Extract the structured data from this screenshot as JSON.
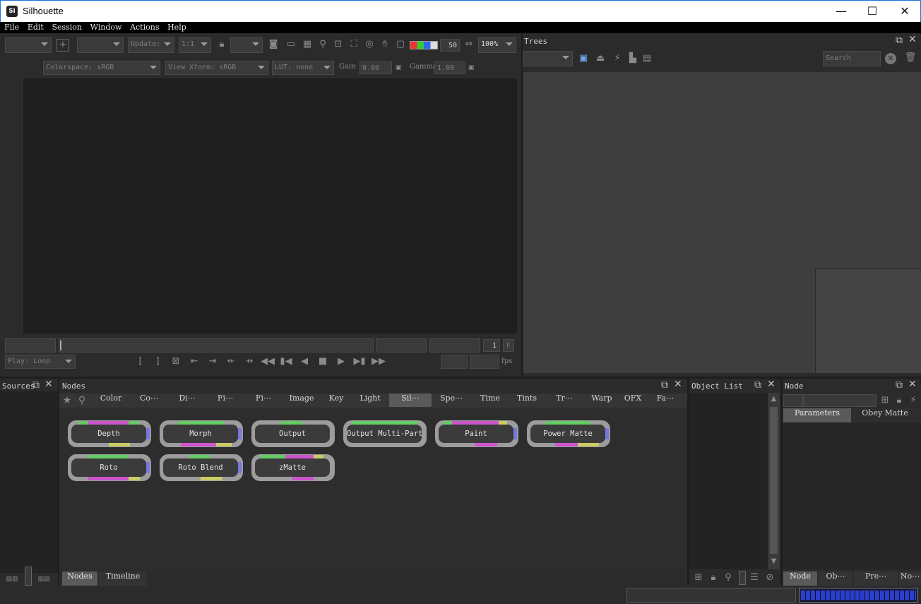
{
  "window": {
    "title": "Silhouette",
    "logo_text": "Si",
    "min": "—",
    "max": "☐",
    "close": "✕"
  },
  "menu": [
    "File",
    "Edit",
    "Session",
    "Window",
    "Actions",
    "Help"
  ],
  "viewer": {
    "update_label": "Update:",
    "ratio": "1:1",
    "value_50": "50",
    "zoom": "100%",
    "colorspace": "Colorspace: sRGB",
    "view_xform": "View Xform: sRGB",
    "lut": "LUT: none",
    "gain_label": "Gain",
    "gain_value": "0.00",
    "gamma_label": "Gamma",
    "gamma_value": "1.00",
    "frame_value": "1",
    "frame_mode": "F",
    "play_mode": "Play: Loop",
    "fps_label": "fps"
  },
  "trees": {
    "title": "Trees",
    "search_placeholder": "Search"
  },
  "sources": {
    "title": "Sources"
  },
  "nodes": {
    "title": "Nodes",
    "categories": [
      "Color",
      "Co⋯",
      "Di⋯",
      "Fi⋯",
      "Fi⋯",
      "Image",
      "Key",
      "Light",
      "Sil⋯",
      "Spe⋯",
      "Time",
      "Tints",
      "Tr⋯",
      "Warp",
      "OFX",
      "Fa⋯"
    ],
    "active_category": "Sil⋯",
    "items": [
      "Depth",
      "Morph",
      "Output",
      "Output Multi-Part",
      "Paint",
      "Power Matte",
      "Roto",
      "Roto Blend",
      "zMatte"
    ],
    "tabs": [
      "Nodes",
      "Timeline"
    ]
  },
  "object_list": {
    "title": "Object List"
  },
  "node_panel": {
    "title": "Node",
    "tabs": [
      "Parameters",
      "Obey Matte"
    ],
    "bottom_tabs": [
      "Node",
      "Ob⋯",
      "Pre⋯",
      "No⋯"
    ]
  },
  "colors": {
    "accent_blue": "#1a73d9",
    "active_tab": "#5a5a5a",
    "node_port": "#7777dd"
  }
}
